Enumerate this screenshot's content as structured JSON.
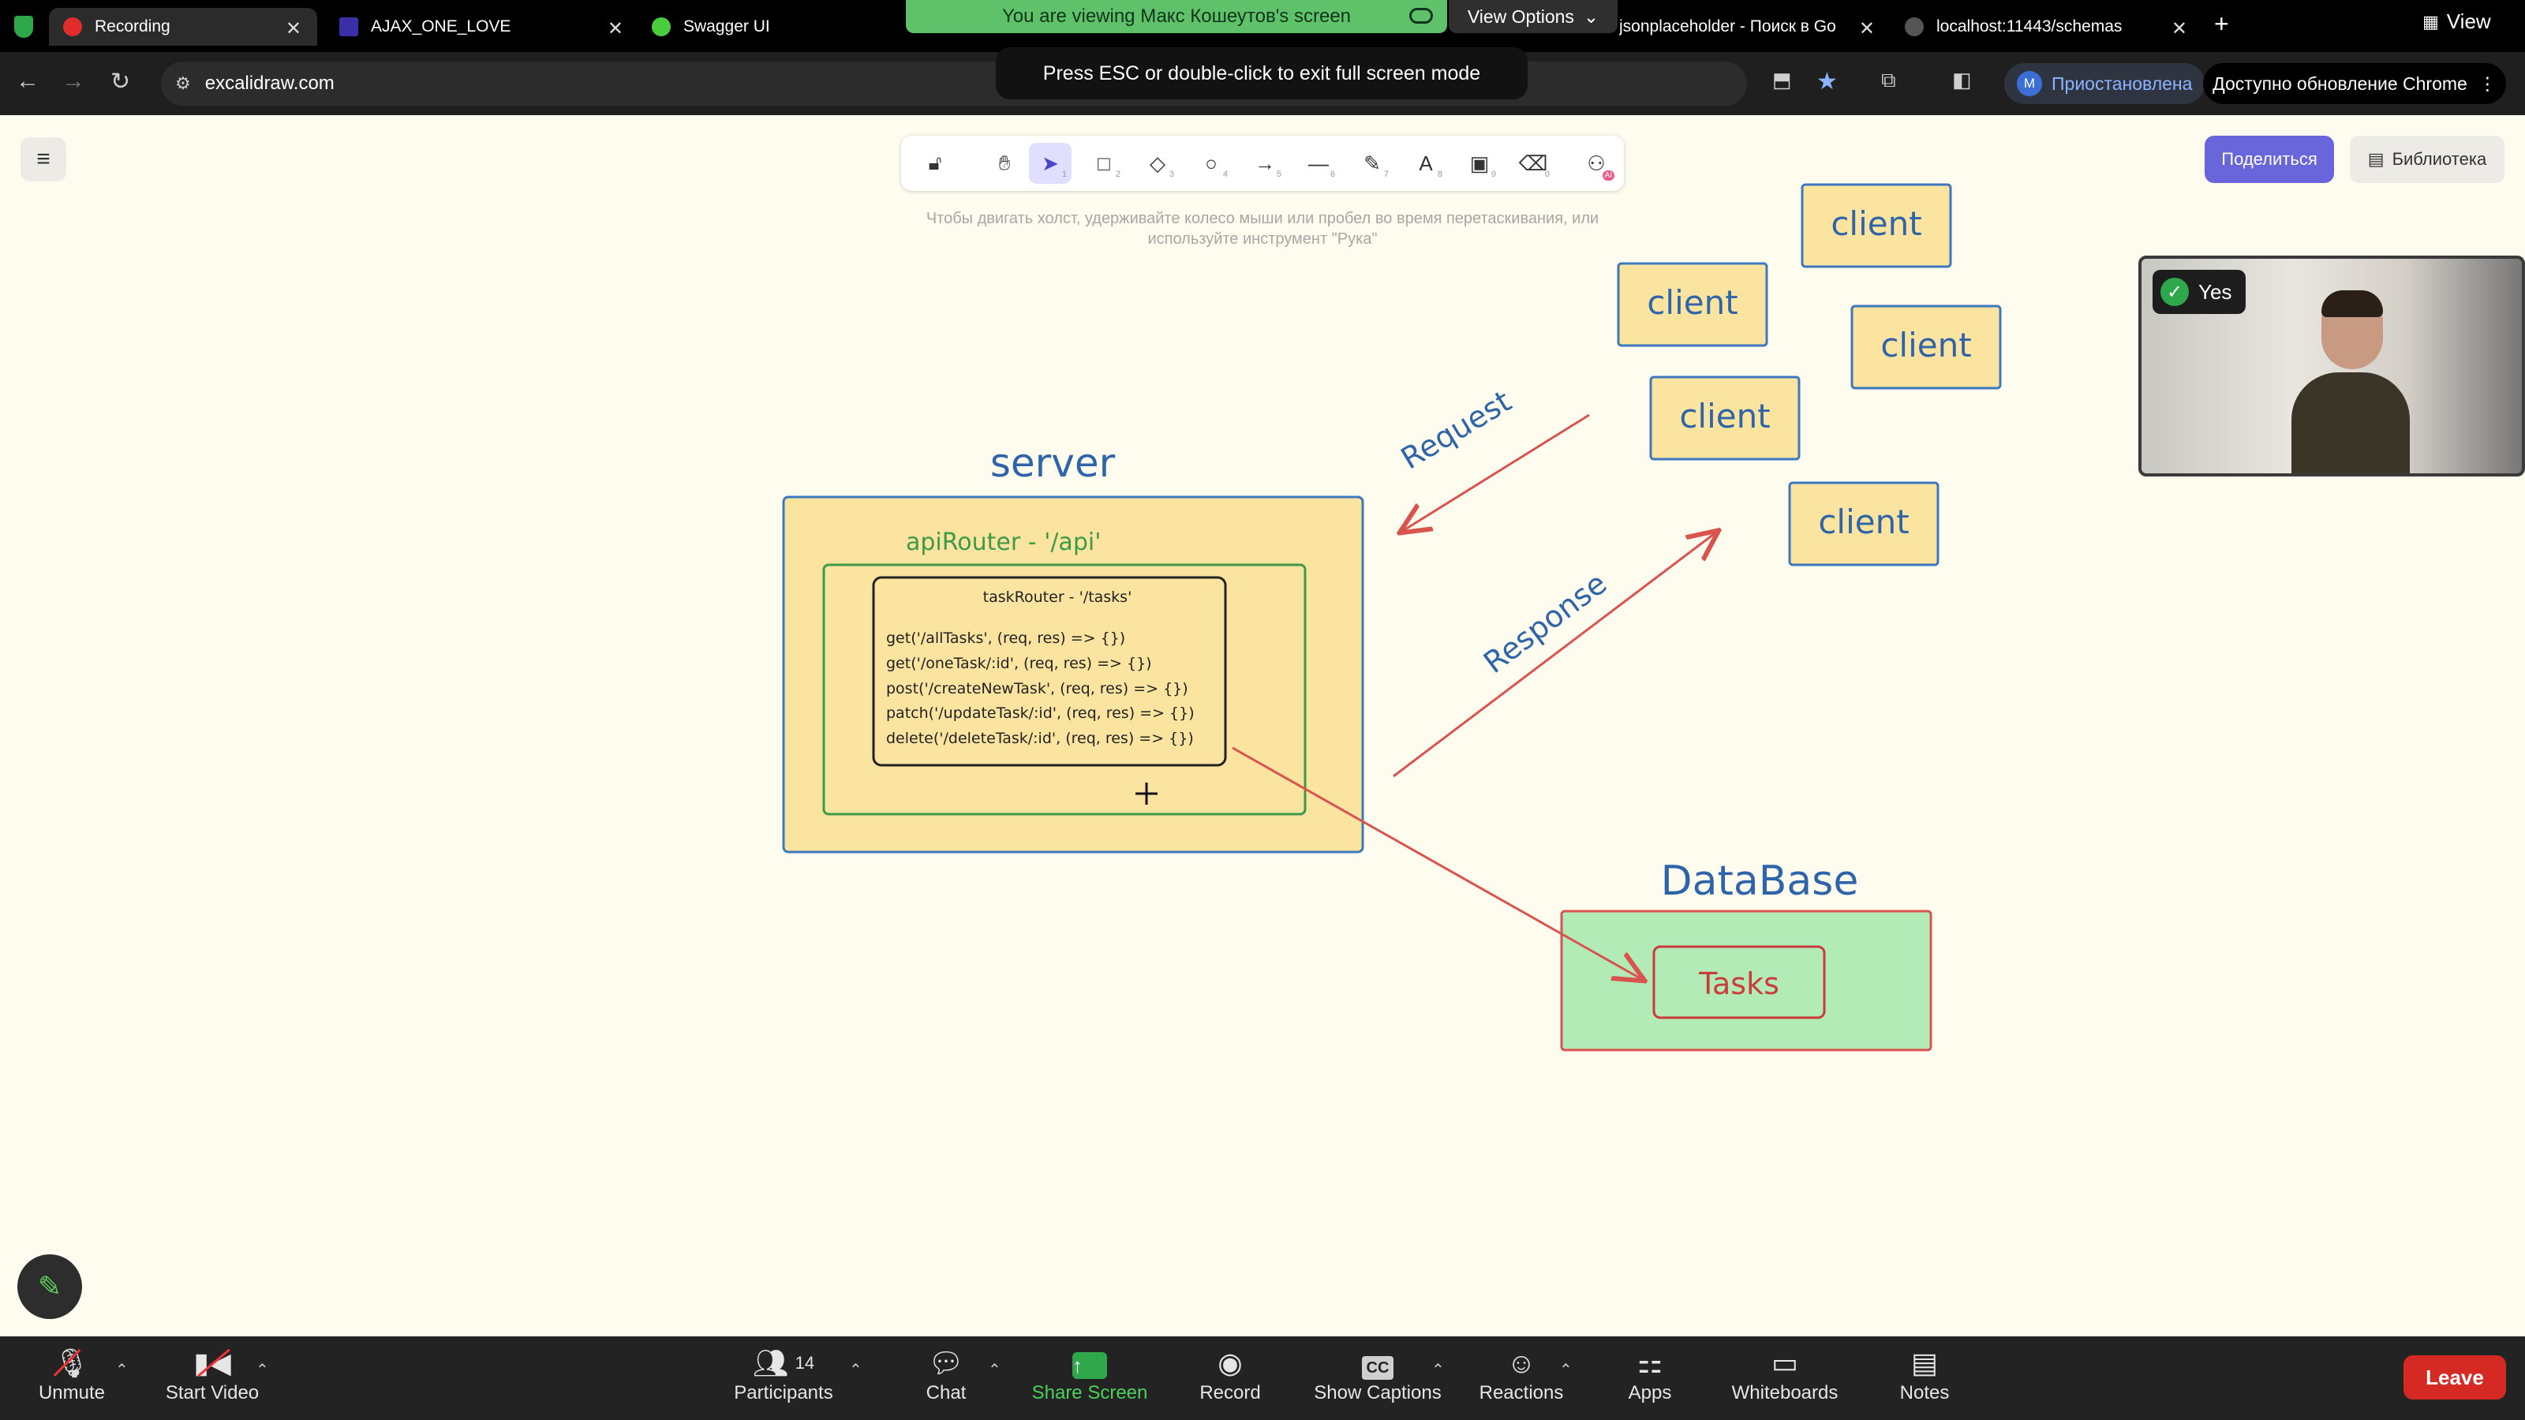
{
  "browser": {
    "tabs": [
      {
        "title": "Recording"
      },
      {
        "title": "AJAX_ONE_LOVE"
      },
      {
        "title": "Swagger UI"
      },
      {
        "title": "jsonplaceholder - Поиск в Go"
      },
      {
        "title": "localhost:11443/schemas"
      }
    ],
    "new_tab": "+",
    "url": "excalidraw.com",
    "profile_initial": "M",
    "profile_status": "Приостановлена",
    "update_label": "Доступно обновление Chrome"
  },
  "share_banner": {
    "text": "You are viewing Макс Кошеутов's screen",
    "view_options": "View Options",
    "fullscreen_notice": "Press ESC or double-click to exit full screen mode",
    "view_label": "View"
  },
  "excalidraw": {
    "tool_shortcuts": [
      "1",
      "2",
      "3",
      "4",
      "5",
      "6",
      "7",
      "8",
      "9",
      "0"
    ],
    "hint": "Чтобы двигать холст, удерживайте колесо мыши или пробел во время перетаскивания, или используйте инструмент \"Рука\"",
    "share_label": "Поделиться",
    "library_label": "Библиотека",
    "ai_badge": "AI"
  },
  "canvas": {
    "server_title": "server",
    "api_router": "apiRouter - '/api'",
    "task_router": "taskRouter - '/tasks'",
    "routes": [
      "get('/allTasks', (req, res) => {})",
      "get('/oneTask/:id', (req, res) => {})",
      "post('/createNewTask', (req, res) => {})",
      "patch('/updateTask/:id', (req, res) => {})",
      "delete('/deleteTask/:id', (req, res) => {})"
    ],
    "clients": [
      "client",
      "client",
      "client",
      "client",
      "client"
    ],
    "request_label": "Request",
    "response_label": "Response",
    "database_title": "DataBase",
    "tasks_label": "Tasks",
    "colors": {
      "box_fill": "#fbe4a0",
      "box_stroke_blue": "#3c78c0",
      "router_green": "#3f9a48",
      "arrow_red": "#d9534f",
      "db_fill": "#b2ebb6",
      "title_blue": "#2f65a8",
      "tasks_red": "#cc3b3b"
    }
  },
  "video": {
    "status": "Yes"
  },
  "zoom": {
    "unmute": "Unmute",
    "start_video": "Start Video",
    "participants": "Participants",
    "participants_count": "14",
    "chat": "Chat",
    "share_screen": "Share Screen",
    "record": "Record",
    "show_captions": "Show Captions",
    "captions_icon": "CC",
    "reactions": "Reactions",
    "apps": "Apps",
    "whiteboards": "Whiteboards",
    "notes": "Notes",
    "leave": "Leave"
  }
}
